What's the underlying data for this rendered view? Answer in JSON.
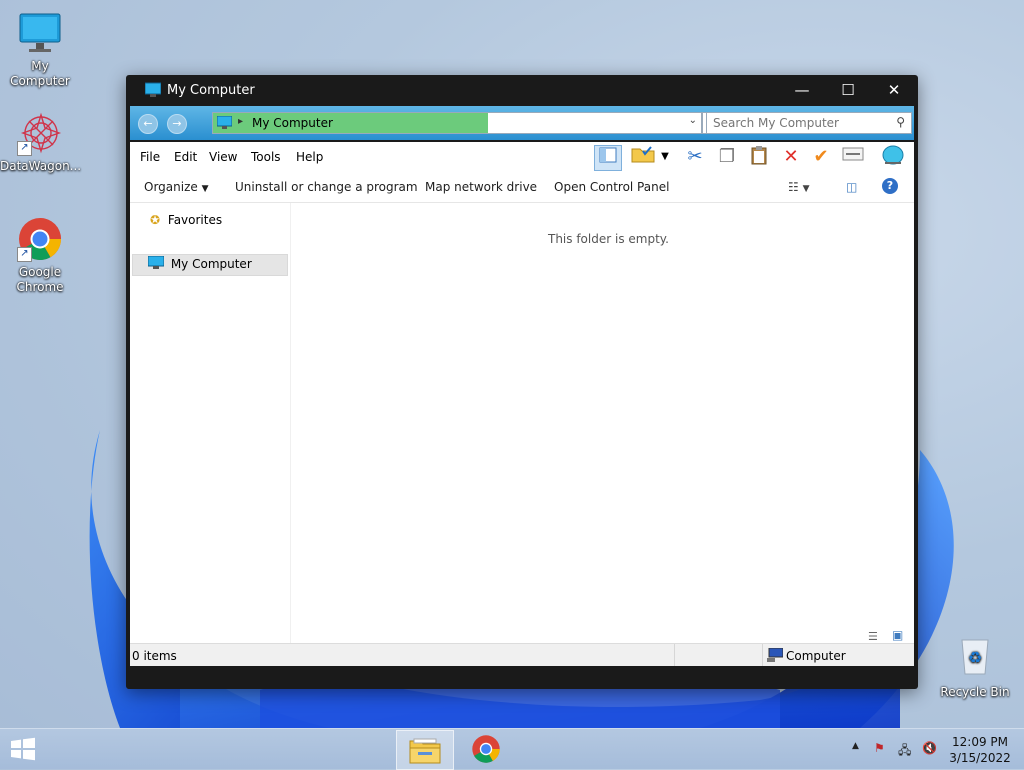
{
  "desktop": {
    "icons": [
      {
        "label": "My Computer"
      },
      {
        "label": "DataWagon..."
      },
      {
        "label": "Google Chrome"
      },
      {
        "label": "Recycle Bin"
      }
    ]
  },
  "window": {
    "title": "My Computer",
    "buttons": {
      "minimize": "—",
      "maximize": "☐",
      "close": "✕"
    },
    "address": {
      "text": "My Computer",
      "separator": "▸"
    },
    "search": {
      "placeholder": "Search My Computer"
    },
    "menu": [
      "File",
      "Edit",
      "View",
      "Tools",
      "Help"
    ],
    "commands": {
      "organize": "Organize",
      "uninstall": "Uninstall or change a program",
      "map_drive": "Map network drive",
      "control_panel": "Open Control Panel"
    },
    "sidebar": {
      "favorites": "Favorites",
      "computer": "My Computer"
    },
    "empty_message": "This folder is empty.",
    "status": {
      "items": "0 items",
      "location": "Computer"
    }
  },
  "taskbar": {
    "clock_time": "12:09 PM",
    "clock_date": "3/15/2022"
  },
  "colors": {
    "address_bar": "#2a8fd0",
    "breadcrumb_fill": "#6ccb7c",
    "title_bar": "#1a1a1a"
  }
}
